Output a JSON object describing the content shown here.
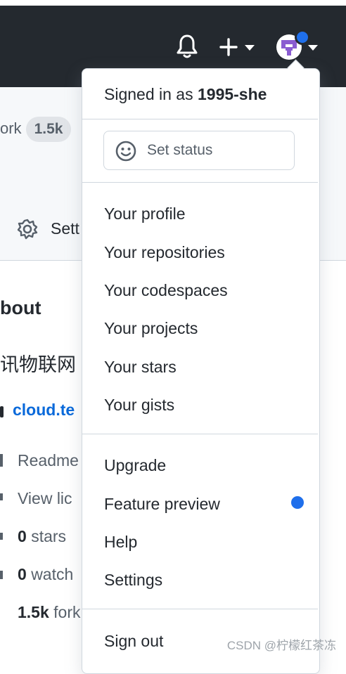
{
  "header": {
    "icons": [
      "bell-icon",
      "plus-icon",
      "caret-down-icon",
      "avatar",
      "caret-down-icon"
    ],
    "background_color": "#24292f",
    "notification_dot_color": "#1f6feb"
  },
  "repo_page": {
    "fork_label": "ork",
    "fork_count": "1.5k",
    "settings_tab": "Sett",
    "about_heading": "bout",
    "description": "讯物联网",
    "link": "cloud.te",
    "readme": "Readme",
    "license": "View lic",
    "stars_count": "0",
    "stars_label": "stars",
    "watch_count": "0",
    "watch_label": "watch",
    "forks_count": "1.5k",
    "forks_label": "fork"
  },
  "menu": {
    "signed_in_prefix": "Signed in as",
    "username": "1995-she",
    "set_status": "Set status",
    "items_group1": [
      "Your profile",
      "Your repositories",
      "Your codespaces",
      "Your projects",
      "Your stars",
      "Your gists"
    ],
    "items_group2": [
      "Upgrade",
      "Feature preview",
      "Help",
      "Settings"
    ],
    "sign_out": "Sign out"
  },
  "watermark": "CSDN @柠檬红茶冻"
}
